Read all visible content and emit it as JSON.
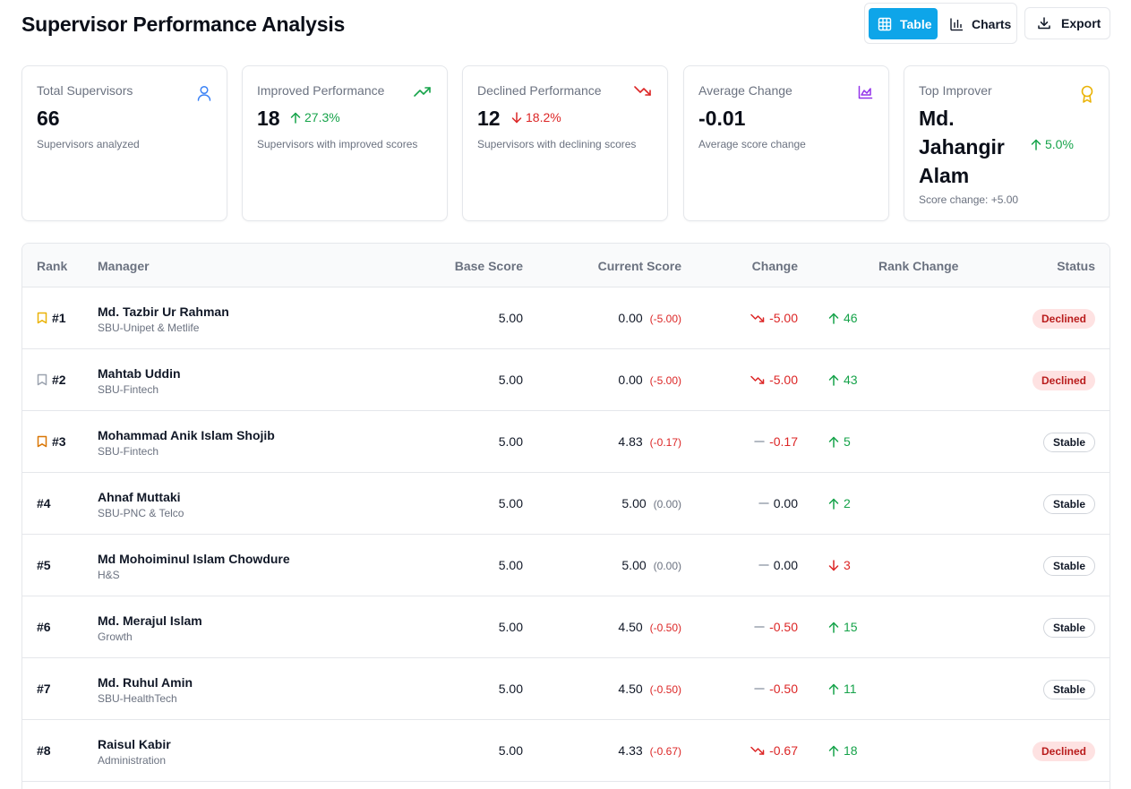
{
  "header": {
    "title": "Supervisor Performance Analysis",
    "view_table_label": "Table",
    "view_charts_label": "Charts",
    "export_label": "Export"
  },
  "colors": {
    "accent": "#0ea5e9",
    "positive": "#16a34a",
    "negative": "#dc2626",
    "declined_badge_bg": "#fee2e2"
  },
  "stats": {
    "total": {
      "label": "Total Supervisors",
      "value": "66",
      "sub": "Supervisors analyzed",
      "icon": "user-icon"
    },
    "improved": {
      "label": "Improved Performance",
      "value": "18",
      "trend": "27.3%",
      "sub": "Supervisors with improved scores",
      "icon": "trending-up-icon"
    },
    "declined": {
      "label": "Declined Performance",
      "value": "12",
      "trend": "18.2%",
      "sub": "Supervisors with declining scores",
      "icon": "trending-down-icon"
    },
    "average": {
      "label": "Average Change",
      "value": "-0.01",
      "sub": "Average score change",
      "icon": "chart-area-icon"
    },
    "top": {
      "label": "Top Improver",
      "name": "Md. Jahangir Alam",
      "trend": "5.0%",
      "sub": "Score change: +5.00",
      "icon": "award-icon"
    }
  },
  "table": {
    "headers": {
      "rank": "Rank",
      "manager": "Manager",
      "base": "Base Score",
      "current": "Current Score",
      "change": "Change",
      "rank_change": "Rank Change",
      "status": "Status"
    },
    "rows": [
      {
        "rank": "#1",
        "name": "Md. Tazbir Ur Rahman",
        "dept": "SBU-Unipet & Metlife",
        "base": "5.00",
        "current": "0.00",
        "delta": "(-5.00)",
        "change": "-5.00",
        "change_dir": "down",
        "rank_change": "46",
        "rank_dir": "up",
        "status": "Declined",
        "bookmark": "gold"
      },
      {
        "rank": "#2",
        "name": "Mahtab Uddin",
        "dept": "SBU-Fintech",
        "base": "5.00",
        "current": "0.00",
        "delta": "(-5.00)",
        "change": "-5.00",
        "change_dir": "down",
        "rank_change": "43",
        "rank_dir": "up",
        "status": "Declined",
        "bookmark": "silver"
      },
      {
        "rank": "#3",
        "name": "Mohammad Anik Islam Shojib",
        "dept": "SBU-Fintech",
        "base": "5.00",
        "current": "4.83",
        "delta": "(-0.17)",
        "change": "-0.17",
        "change_dir": "flat-neg",
        "rank_change": "5",
        "rank_dir": "up",
        "status": "Stable",
        "bookmark": "bronze"
      },
      {
        "rank": "#4",
        "name": "Ahnaf Muttaki",
        "dept": "SBU-PNC & Telco",
        "base": "5.00",
        "current": "5.00",
        "delta": "(0.00)",
        "change": "0.00",
        "change_dir": "flat",
        "rank_change": "2",
        "rank_dir": "up",
        "status": "Stable",
        "bookmark": ""
      },
      {
        "rank": "#5",
        "name": "Md Mohoiminul Islam Chowdure",
        "dept": "H&S",
        "base": "5.00",
        "current": "5.00",
        "delta": "(0.00)",
        "change": "0.00",
        "change_dir": "flat",
        "rank_change": "3",
        "rank_dir": "down",
        "status": "Stable",
        "bookmark": ""
      },
      {
        "rank": "#6",
        "name": "Md. Merajul Islam",
        "dept": "Growth",
        "base": "5.00",
        "current": "4.50",
        "delta": "(-0.50)",
        "change": "-0.50",
        "change_dir": "flat-neg",
        "rank_change": "15",
        "rank_dir": "up",
        "status": "Stable",
        "bookmark": ""
      },
      {
        "rank": "#7",
        "name": "Md. Ruhul Amin",
        "dept": "SBU-HealthTech",
        "base": "5.00",
        "current": "4.50",
        "delta": "(-0.50)",
        "change": "-0.50",
        "change_dir": "flat-neg",
        "rank_change": "11",
        "rank_dir": "up",
        "status": "Stable",
        "bookmark": ""
      },
      {
        "rank": "#8",
        "name": "Raisul Kabir",
        "dept": "Administration",
        "base": "5.00",
        "current": "4.33",
        "delta": "(-0.67)",
        "change": "-0.67",
        "change_dir": "down",
        "rank_change": "18",
        "rank_dir": "up",
        "status": "Declined",
        "bookmark": ""
      }
    ]
  }
}
